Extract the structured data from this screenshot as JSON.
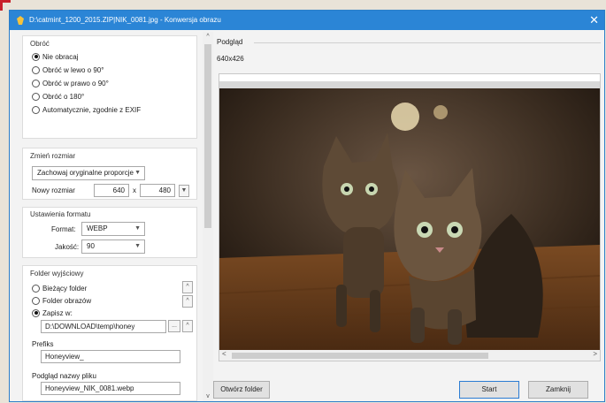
{
  "window": {
    "title": "D:\\catmint_1200_2015.ZIP|NIK_0081.jpg - Konwersja obrazu",
    "close_glyph": "✕"
  },
  "rotate": {
    "title": "Obróć",
    "options": [
      {
        "label": "Nie obracaj",
        "selected": true
      },
      {
        "label": "Obróć w lewo o 90°",
        "selected": false
      },
      {
        "label": "Obróć w prawo o 90°",
        "selected": false
      },
      {
        "label": "Obróć o 180°",
        "selected": false
      },
      {
        "label": "Automatycznie, zgodnie z EXIF",
        "selected": false
      }
    ]
  },
  "resize": {
    "title": "Zmień rozmiar",
    "mode": "Zachowaj oryginalne proporcje",
    "new_size_label": "Nowy rozmiar",
    "width": "640",
    "x_label": "x",
    "height": "480"
  },
  "format": {
    "title": "Ustawienia formatu",
    "format_label": "Format:",
    "format_value": "WEBP",
    "quality_label": "Jakość:",
    "quality_value": "90"
  },
  "output": {
    "title": "Folder wyjściowy",
    "options": [
      {
        "label": "Bieżący folder",
        "selected": false
      },
      {
        "label": "Folder obrazów",
        "selected": false
      },
      {
        "label": "Zapisz w:",
        "selected": true
      }
    ],
    "path": "D:\\DOWNLOAD\\temp\\honey",
    "browse": "...",
    "prefix_label": "Prefiks",
    "prefix_value": "Honeyview_",
    "filename_preview_label": "Podgląd nazwy pliku",
    "filename_preview_value": "Honeyview_NIK_0081.webp"
  },
  "preview": {
    "title": "Podgląd",
    "dimensions": "640x426"
  },
  "buttons": {
    "open_folder": "Otwórz folder",
    "start": "Start",
    "close": "Zamknij"
  },
  "colors": {
    "titlebar": "#2b85d6",
    "annotation": "#c8202a",
    "primary_border": "#2b7cd3"
  }
}
